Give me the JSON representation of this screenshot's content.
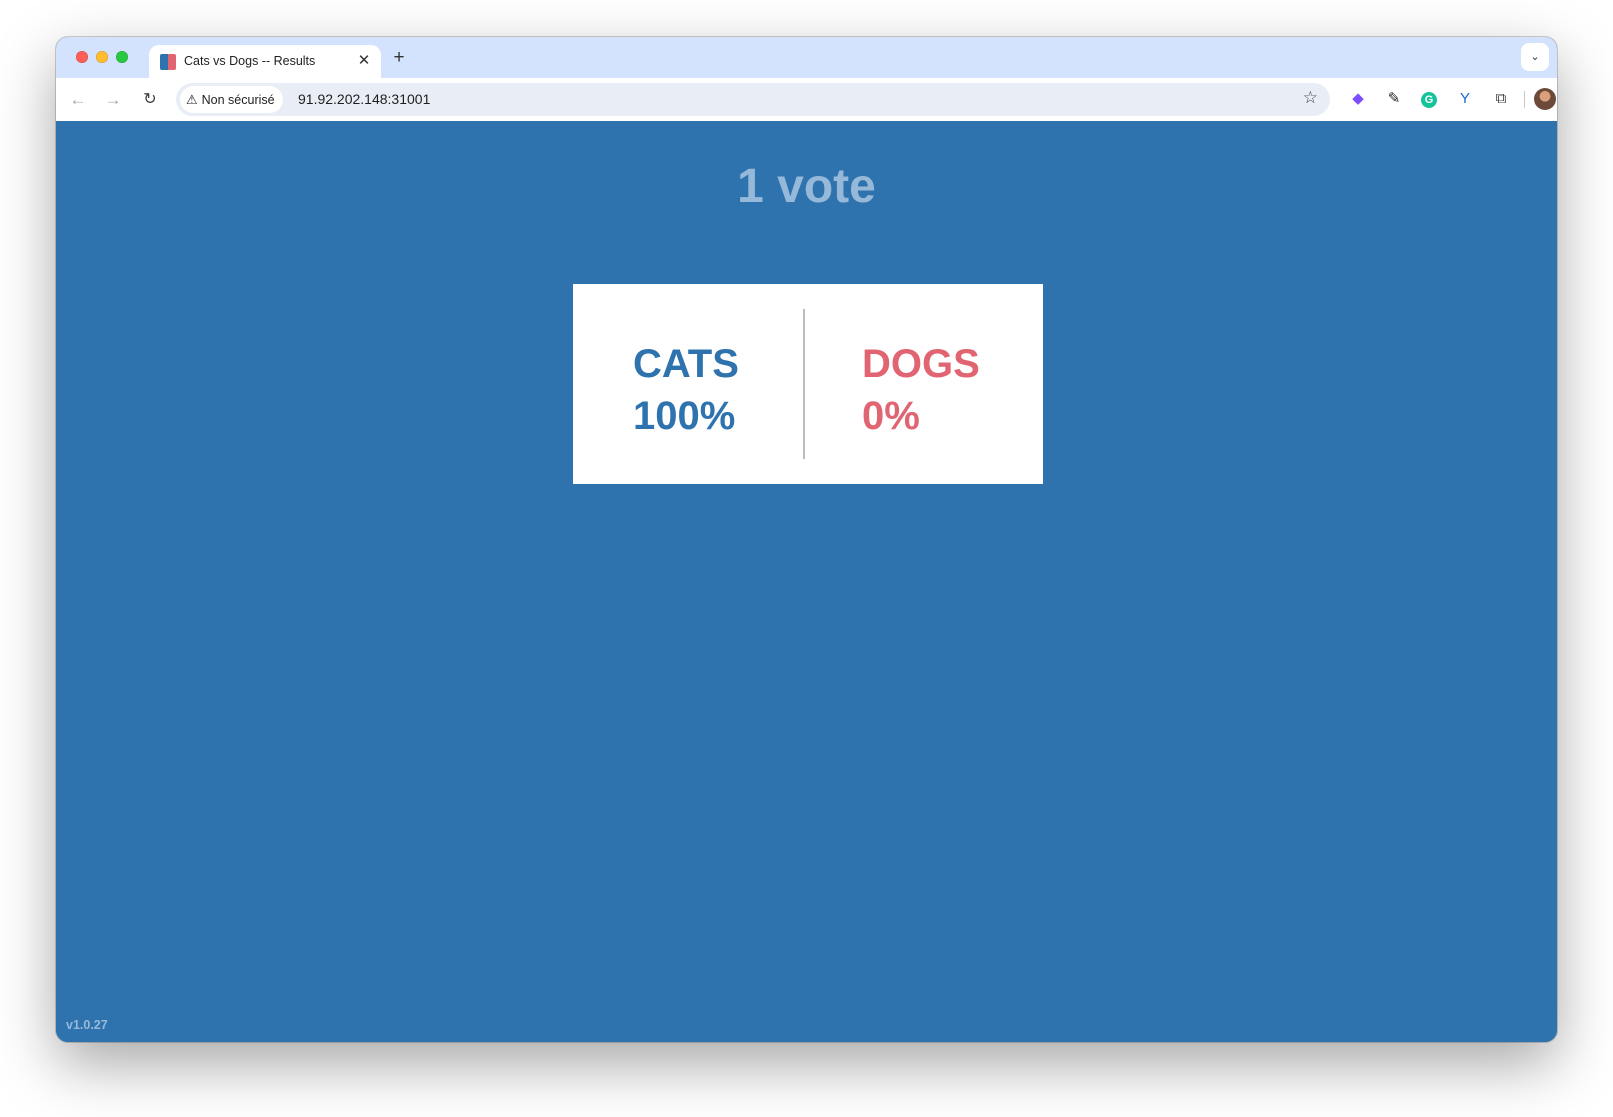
{
  "browser": {
    "tab": {
      "title": "Cats vs Dogs -- Results",
      "close_glyph": "✕"
    },
    "new_tab_glyph": "+",
    "tab_search_glyph": "⌄",
    "nav": {
      "back_glyph": "←",
      "forward_glyph": "→",
      "reload_glyph": "↻"
    },
    "security_chip": {
      "warning_glyph": "⚠",
      "label": "Non sécurisé"
    },
    "url": "91.92.202.148:31001",
    "bookmark_glyph": "☆",
    "extensions": [
      {
        "icon": "gem-extension-icon",
        "glyph": "◆"
      },
      {
        "icon": "eyedropper-extension-icon",
        "glyph": "✎"
      },
      {
        "icon": "grammarly-extension-icon",
        "glyph": "G"
      },
      {
        "icon": "vue-devtools-extension-icon",
        "glyph": "Y"
      },
      {
        "icon": "puzzle-extensions-icon",
        "glyph": "⧉"
      }
    ],
    "menu_glyph": "⋮"
  },
  "page": {
    "vote_count": "1 vote",
    "options": [
      {
        "label": "CATS",
        "percent": "100%",
        "color": "#2e73ae"
      },
      {
        "label": "DOGS",
        "percent": "0%",
        "color": "#e06472"
      }
    ],
    "version": "v1.0.27",
    "background_color": "#2e73ae"
  }
}
